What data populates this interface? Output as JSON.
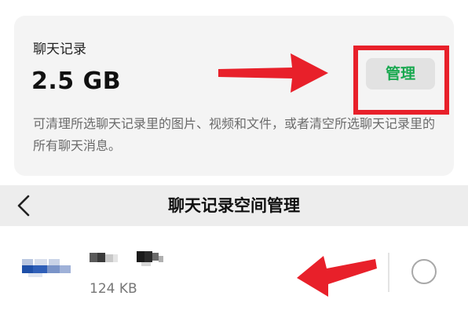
{
  "storage_card": {
    "title": "聊天记录",
    "size": "2.5 GB",
    "description": "可清理所选聊天记录里的图片、视频和文件，或者清空所选聊天记录里的所有聊天消息。",
    "manage_button": "管理"
  },
  "header": {
    "back_icon": "chevron-left-icon",
    "title": "聊天记录空间管理"
  },
  "chat_list": [
    {
      "size": "124 KB",
      "selected": false
    }
  ],
  "colors": {
    "accent_green": "#18a84f",
    "highlight_red": "#e8202a",
    "card_background": "#f4f4f4",
    "header_background": "#ededed"
  }
}
